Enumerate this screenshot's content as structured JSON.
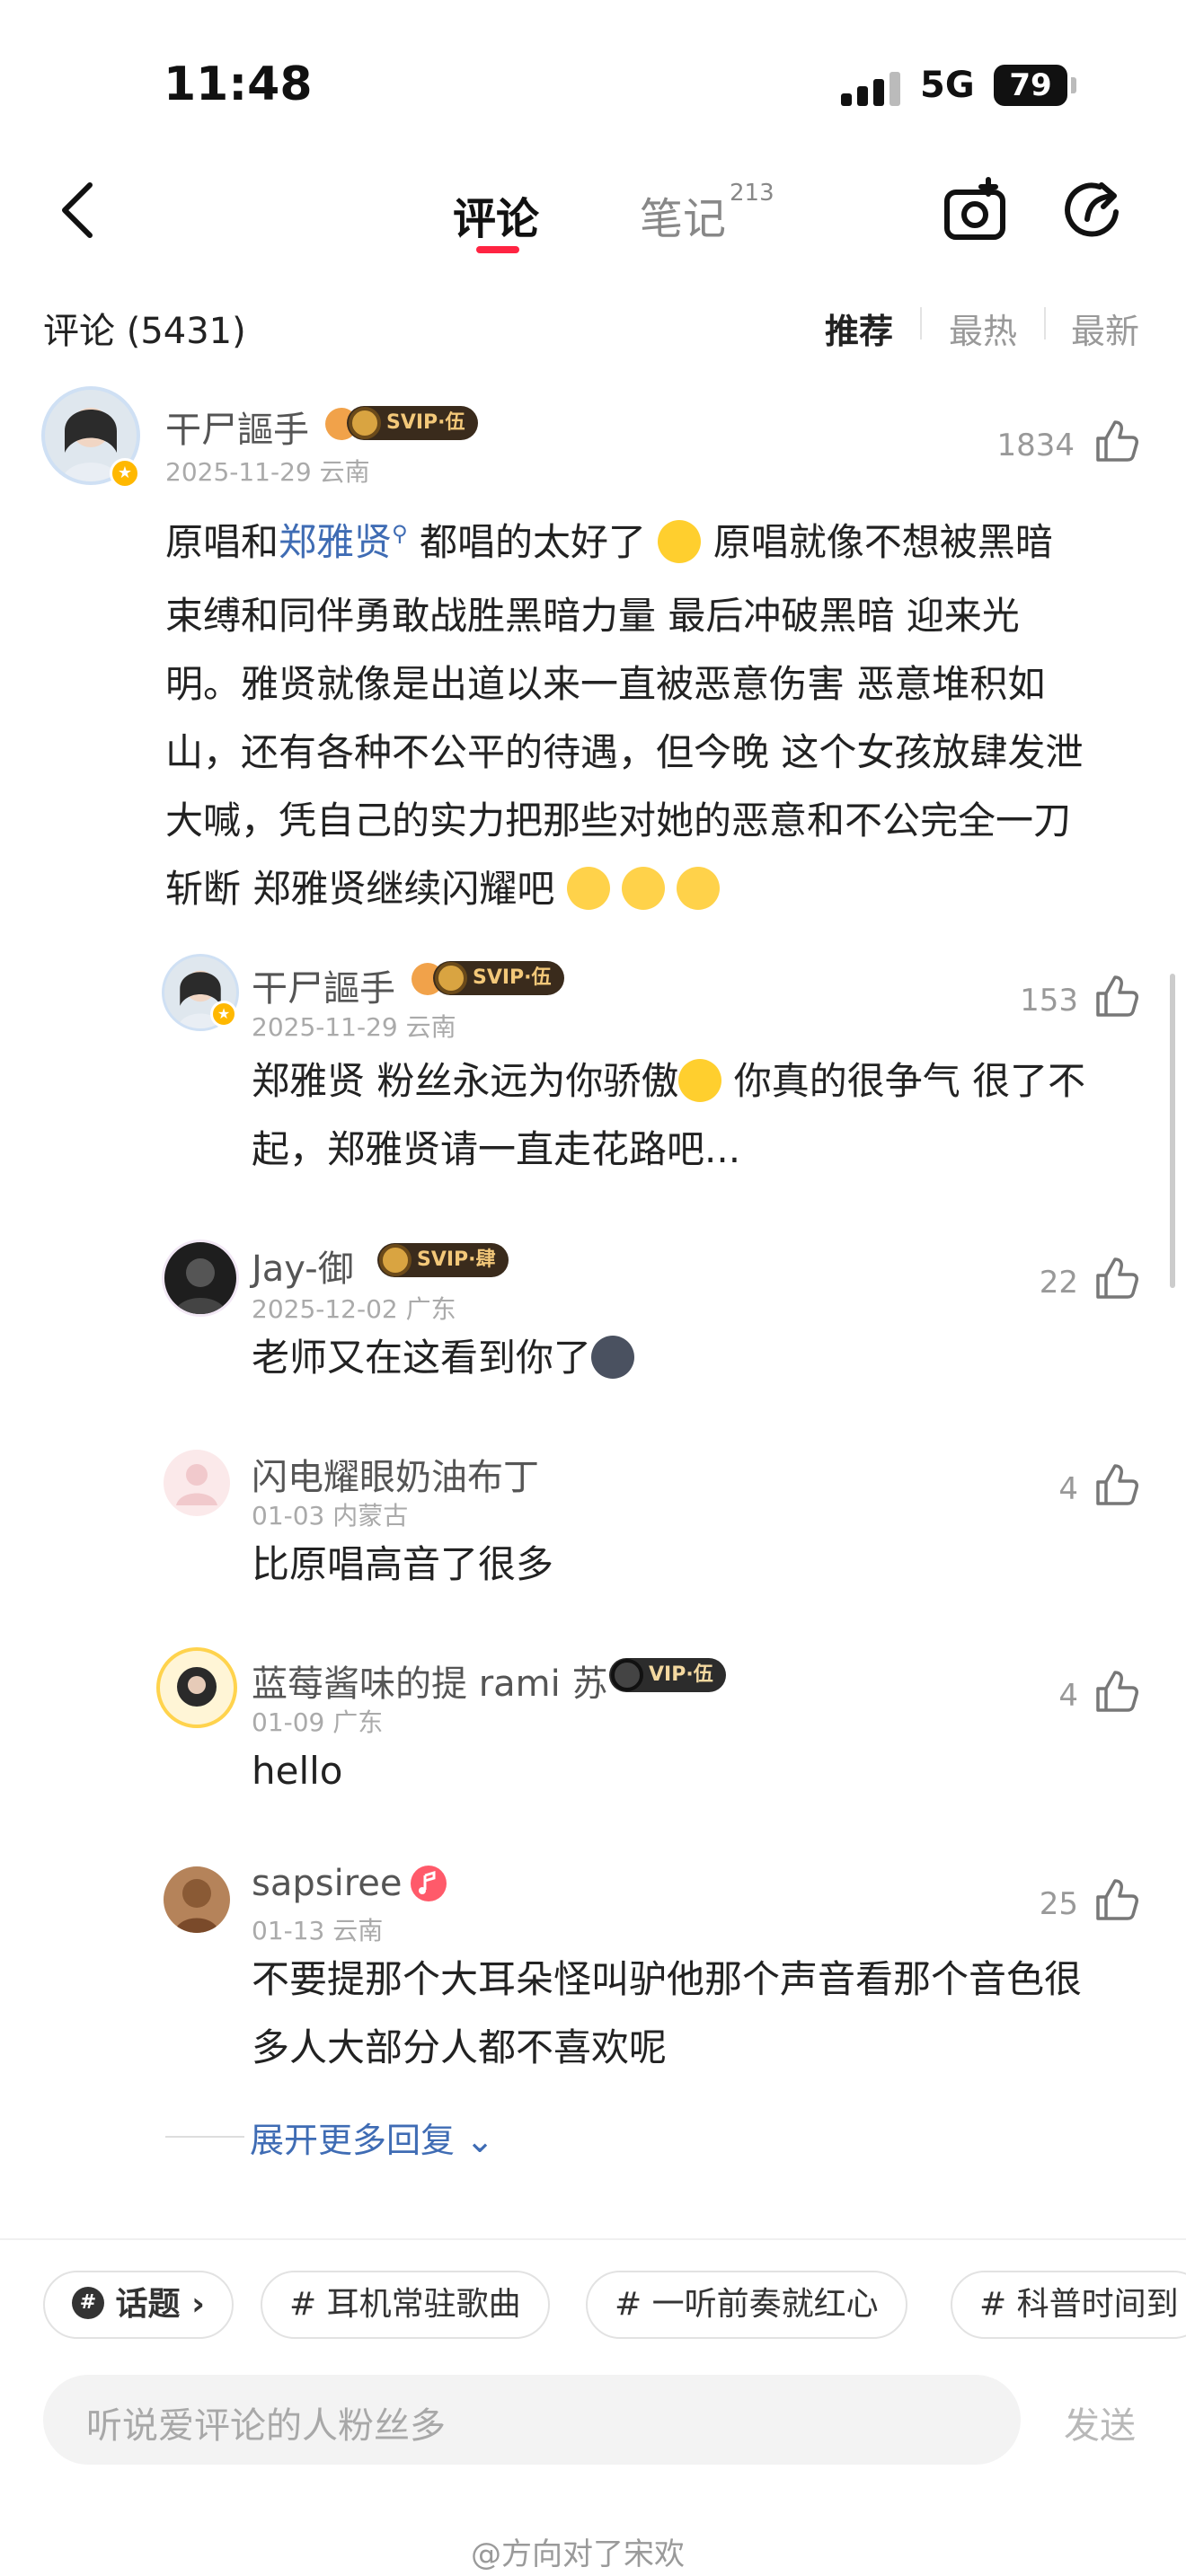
{
  "status_bar": {
    "time": "11:48",
    "network": "5G",
    "battery": "79"
  },
  "nav": {
    "tab_comments": "评论",
    "tab_notes": "笔记",
    "notes_count": "213"
  },
  "header": {
    "comment_count": "评论 (5431)",
    "sort": [
      "推荐",
      "最热",
      "最新"
    ]
  },
  "main_comment": {
    "username": "干尸謳手",
    "vip": "SVIP·伍",
    "meta": "2025-11-29 云南",
    "likes": "1834",
    "text_before": "原唱和",
    "mention": "郑雅贤",
    "text_line1_after": "都唱的太好了",
    "text_line1_tail": "原唱就像不想被黑暗",
    "lines": [
      "束缚和同伴勇敢战胜黑暗力量 最后冲破黑暗 迎来光",
      "明。雅贤就像是出道以来一直被恶意伤害 恶意堆积如",
      "山，还有各种不公平的待遇，但今晚 这个女孩放肆发泄",
      "大喊，凭自己的实力把那些对她的恶意和不公完全一刀"
    ],
    "last_line": "斩断 郑雅贤继续闪耀吧"
  },
  "replies": [
    {
      "username": "干尸謳手",
      "vip": "SVIP·伍",
      "meta": "2025-11-29 云南",
      "likes": "153",
      "line1_a": "郑雅贤 粉丝永远为你骄傲",
      "line1_b": "你真的很争气 很了不",
      "line2": "起，郑雅贤请一直走花路吧..."
    },
    {
      "username": "Jay-御",
      "vip": "SVIP·肆",
      "meta": "2025-12-02 广东",
      "likes": "22",
      "text": "老师又在这看到你了"
    },
    {
      "username": "闪电耀眼奶油布丁",
      "meta": "01-03 内蒙古",
      "likes": "4",
      "text": "比原唱高音了很多"
    },
    {
      "username": "蓝莓酱味的提 rami 苏",
      "vip": "VIP·伍",
      "meta": "01-09 广东",
      "likes": "4",
      "text": "hello"
    },
    {
      "username": "sapsiree",
      "meta": "01-13 云南",
      "likes": "25",
      "line1": "不要提那个大耳朵怪叫驴他那个声音看那个音色很",
      "line2": "多人大部分人都不喜欢呢"
    }
  ],
  "expand": "展开更多回复",
  "topics": [
    "话题",
    "# 耳机常驻歌曲",
    "# 一听前奏就红心",
    "# 科普时间到"
  ],
  "input": {
    "placeholder": "听说爱评论的人粉丝多",
    "send": "发送"
  },
  "watermark": "@方向对了宋欢",
  "colors": {
    "accent": "#ff2442",
    "link": "#3f6cb4",
    "vip_bg": "#3a2b1c",
    "vip_text": "#f3c879"
  }
}
